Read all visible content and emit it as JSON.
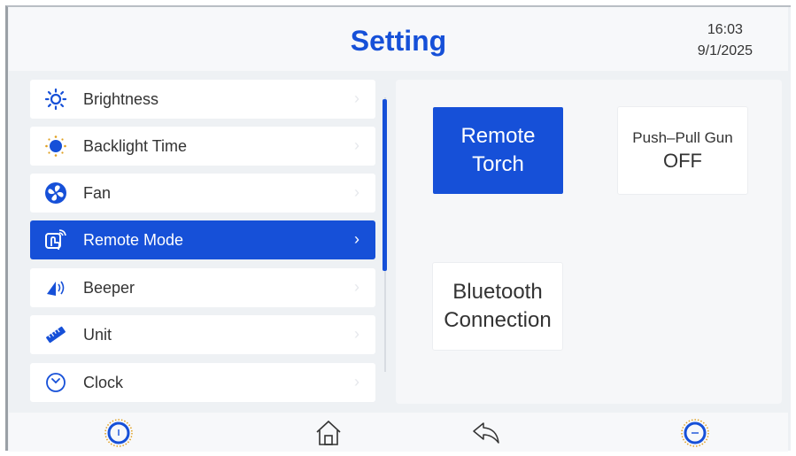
{
  "header": {
    "title": "Setting",
    "time": "16:03",
    "date": "9/1/2025"
  },
  "menu": [
    {
      "label": "Brightness",
      "icon": "sun-icon",
      "active": false
    },
    {
      "label": "Backlight Time",
      "icon": "backlight-icon",
      "active": false
    },
    {
      "label": "Fan",
      "icon": "fan-icon",
      "active": false
    },
    {
      "label": "Remote Mode",
      "icon": "remote-touch-icon",
      "active": true
    },
    {
      "label": "Beeper",
      "icon": "speaker-icon",
      "active": false
    },
    {
      "label": "Unit",
      "icon": "ruler-icon",
      "active": false
    },
    {
      "label": "Clock",
      "icon": "clock-icon",
      "active": false
    }
  ],
  "tiles": {
    "remote_torch": {
      "line1": "Remote",
      "line2": "Torch"
    },
    "push_pull_gun": {
      "label": "Push–Pull Gun",
      "value": "OFF"
    },
    "bluetooth": {
      "line1": "Bluetooth",
      "line2": "Connection"
    }
  },
  "bottom_bar": [
    "knob-left-icon",
    "home-icon",
    "back-icon",
    "knob-right-icon"
  ],
  "colors": {
    "accent": "#1650d8",
    "background": "#eef1f4",
    "panel": "#f6f7f9",
    "text": "#333333"
  }
}
